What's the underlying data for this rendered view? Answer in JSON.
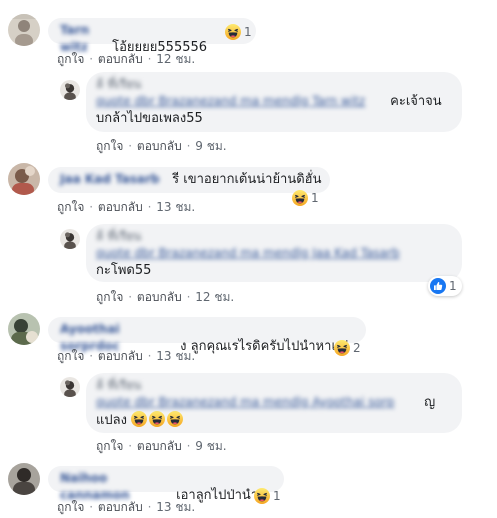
{
  "comments": [
    {
      "text": "โอ้ยยยย555556",
      "reaction_count": "1",
      "like": "ถูกใจ",
      "reply": "ตอบกลับ",
      "time": "12 ชม.",
      "reply_item": {
        "text_line1": "คะเจ้าจน",
        "text_line2": "บกล้าไปขอเพลง55",
        "like": "ถูกใจ",
        "reply": "ตอบกลับ",
        "time": "9 ชม."
      }
    },
    {
      "text": "รี เขาอยากเต้นน่าย้านดิฮั่น",
      "reaction_count": "1",
      "like": "ถูกใจ",
      "reply": "ตอบกลับ",
      "time": "13 ชม.",
      "reply_item": {
        "text_line1": "กะโพด55",
        "reaction_count": "1",
        "like": "ถูกใจ",
        "reply": "ตอบกลับ",
        "time": "12 ชม."
      }
    },
    {
      "text": "ง ลูกคุณเรไรดิครับไปนำหาแม่",
      "reaction_count": "2",
      "like": "ถูกใจ",
      "reply": "ตอบกลับ",
      "time": "13 ชม.",
      "reply_item": {
        "text_line1": "ญ",
        "text_line2": "แปลง",
        "like": "ถูกใจ",
        "reply": "ตอบกลับ",
        "time": "9 ชม."
      }
    },
    {
      "text": "เอาลูกไปป่านำดิ",
      "reaction_count": "1",
      "like": "ถูกใจ",
      "reply": "ตอบกลับ",
      "time": "13 ชม."
    }
  ],
  "separator": "·",
  "colors": {
    "bubble": "#f2f3f5",
    "meta": "#606770",
    "name_blurred": "#385898",
    "like_blue": "#1877f2",
    "haha_yellow": "#f7c744"
  },
  "icons": {
    "haha": "haha-reaction-icon",
    "like": "like-reaction-icon"
  }
}
